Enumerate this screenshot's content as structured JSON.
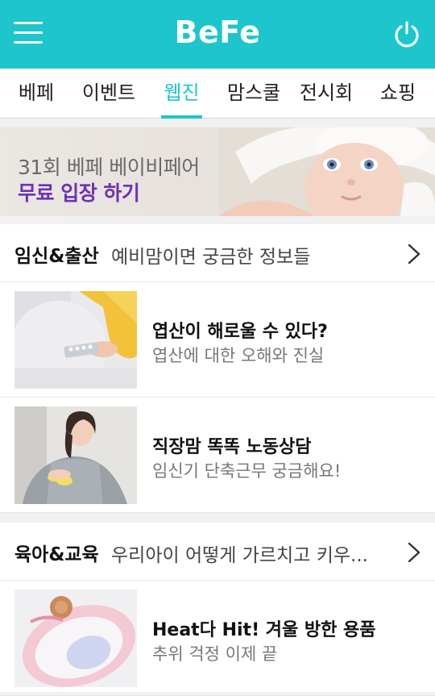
{
  "app": {
    "logo": "BeFe"
  },
  "header": {
    "menu_icon": "hamburger-menu-icon",
    "power_icon": "power-icon"
  },
  "tabs": [
    {
      "label": "베페",
      "active": false
    },
    {
      "label": "이벤트",
      "active": false
    },
    {
      "label": "웹진",
      "active": true
    },
    {
      "label": "맘스쿨",
      "active": false
    },
    {
      "label": "전시회",
      "active": false
    },
    {
      "label": "쇼핑",
      "active": false
    }
  ],
  "banner": {
    "line1": "31회 베페 베이비페어",
    "line2": "무료 입장 하기"
  },
  "sections": [
    {
      "title": "임신&출산",
      "subtitle": "예비맘이면 궁금한 정보들",
      "items": [
        {
          "title": "엽산이 해로울 수 있다?",
          "subtitle": "엽산에 대한 오해와 진실"
        },
        {
          "title": "직장맘 똑똑 노동상담",
          "subtitle": "임신기 단축근무 궁금해요!"
        }
      ]
    },
    {
      "title": "육아&교육",
      "subtitle": "우리아이 어떻게 가르치고 키우...",
      "items": [
        {
          "title": "Heat다 Hit! 겨울 방한 용품",
          "subtitle": "추위 걱정 이제 끝"
        }
      ]
    }
  ],
  "colors": {
    "accent": "#1cc6cc",
    "banner_cta": "#6d32b6",
    "background": "#f1f1f1"
  }
}
